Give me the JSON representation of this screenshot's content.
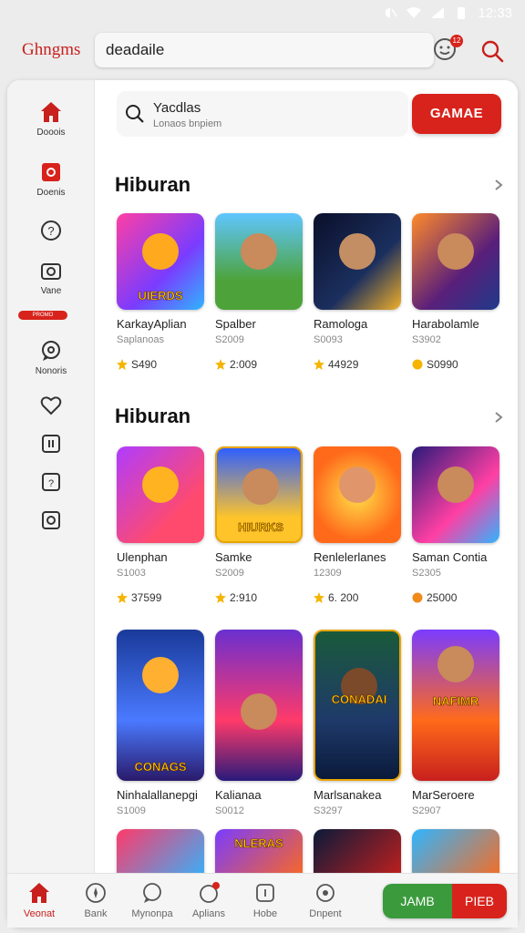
{
  "status_bar": {
    "time": "12:33",
    "icons": [
      "mute-icon",
      "wifi-icon",
      "signal-icon",
      "battery-icon"
    ]
  },
  "topbar": {
    "brand": "Ghngms",
    "search_value": "deadaile",
    "notification_count": "12"
  },
  "sidebar": {
    "items": [
      {
        "icon": "home-icon",
        "label": "Dooois"
      },
      {
        "icon": "video-icon",
        "label": "Doenis"
      },
      {
        "icon": "help-icon",
        "label": ""
      },
      {
        "icon": "camera-icon",
        "label": "Vane"
      },
      {
        "icon": "chat-bubble-icon",
        "label": "Nonoris"
      },
      {
        "icon": "heart-bubble-icon",
        "label": ""
      },
      {
        "icon": "pause-icon",
        "label": ""
      },
      {
        "icon": "question-square-icon",
        "label": ""
      },
      {
        "icon": "record-icon",
        "label": ""
      }
    ],
    "promo_pill": "PROMO"
  },
  "content_search": {
    "title": "Yacdlas",
    "subtitle": "Lonaos bnpiem",
    "button_label": "GAMAE"
  },
  "accent": "#d8231c",
  "sections": [
    {
      "title": "Hiburan",
      "rows": [
        [
          {
            "name": "KarkayAplian",
            "sub": "Saplanoas",
            "rating": "S490",
            "banner": "UIERDS"
          },
          {
            "name": "Spalber",
            "sub": "S2009",
            "rating": "2:009",
            "banner": ""
          },
          {
            "name": "Ramologa",
            "sub": "S0093",
            "rating": "44929",
            "banner": ""
          },
          {
            "name": "Harabolamle",
            "sub": "S3902",
            "rating": "S0990",
            "banner": ""
          }
        ]
      ]
    },
    {
      "title": "Hiburan",
      "rows": [
        [
          {
            "name": "Ulenphan",
            "sub": "S1003",
            "rating": "37599",
            "banner": ""
          },
          {
            "name": "Samke",
            "sub": "S2009",
            "rating": "2:910",
            "banner": "HIURKS"
          },
          {
            "name": "Renlelerlanes",
            "sub": "12309",
            "rating": "6. 200",
            "banner": ""
          },
          {
            "name": "Saman Contia",
            "sub": "S2305",
            "rating": "25000",
            "banner": ""
          }
        ],
        [
          {
            "name": "Ninhalallanepgi",
            "sub": "S1009",
            "rating": "",
            "banner": "CONAGS"
          },
          {
            "name": "Kalianaa",
            "sub": "S0012",
            "rating": "",
            "banner": ""
          },
          {
            "name": "Marlsanakea",
            "sub": "S3297",
            "rating": "",
            "banner": "CONADAI"
          },
          {
            "name": "MarSeroere",
            "sub": "S2907",
            "rating": "",
            "banner": "NAFIMR"
          }
        ],
        [
          {
            "name": "",
            "sub": "",
            "rating": "",
            "banner": ""
          },
          {
            "name": "",
            "sub": "",
            "rating": "",
            "banner": "NLERAS"
          },
          {
            "name": "",
            "sub": "",
            "rating": "",
            "banner": ""
          },
          {
            "name": "",
            "sub": "",
            "rating": "",
            "banner": ""
          }
        ]
      ]
    }
  ],
  "bottom_nav": {
    "items": [
      {
        "icon": "home-icon",
        "label": "Veonat",
        "active": true
      },
      {
        "icon": "compass-icon",
        "label": "Bank",
        "active": false
      },
      {
        "icon": "chat-icon",
        "label": "Mynonpa",
        "active": false
      },
      {
        "icon": "apps-icon",
        "label": "Aplians",
        "active": false
      },
      {
        "icon": "box-icon",
        "label": "Hobe",
        "active": false
      },
      {
        "icon": "settings-icon",
        "label": "Dnpent",
        "active": false
      }
    ],
    "pill_left": "JAMB",
    "pill_right": "PIEB"
  }
}
